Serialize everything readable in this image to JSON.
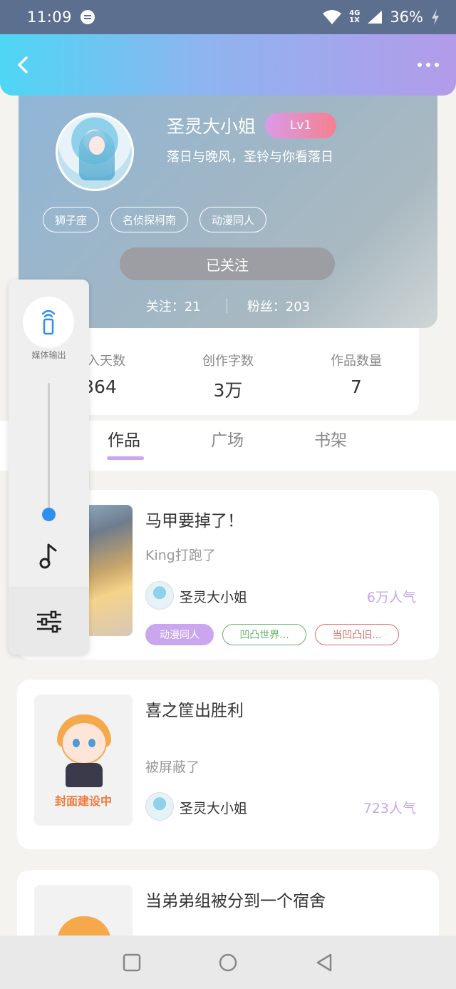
{
  "status_bar": {
    "time": "11:09",
    "network_top": "4G",
    "network_bottom": "1X",
    "battery": "36%"
  },
  "header": {
    "back_icon": "back-arrow-icon",
    "more_icon": "more-dots-icon"
  },
  "profile": {
    "name": "圣灵大小姐",
    "level": "Lv1",
    "signature": "落日与晚风，圣铃与你看落日",
    "tags": [
      "狮子座",
      "名侦探柯南",
      "动漫同人"
    ],
    "follow_button": "已关注",
    "following": "关注：21",
    "followers": "粉丝：203"
  },
  "stats": [
    {
      "label": "加入天数",
      "value": "364"
    },
    {
      "label": "创作字数",
      "value": "3万"
    },
    {
      "label": "作品数量",
      "value": "7"
    }
  ],
  "tabs": [
    "作品",
    "广场",
    "书架"
  ],
  "works": [
    {
      "title": "马甲要掉了！",
      "desc": "King打跑了",
      "author": "圣灵大小姐",
      "popularity": "6万人气",
      "tags": [
        {
          "text": "动漫同人",
          "style": "filled",
          "color": "#c9a6ee"
        },
        {
          "text": "凹凸世界...",
          "style": "outline",
          "color": "#62b46b"
        },
        {
          "text": "当凹凸旧...",
          "style": "outline",
          "color": "#e26a6a"
        }
      ]
    },
    {
      "title": "喜之筐出胜利",
      "desc": "被屏蔽了",
      "author": "圣灵大小姐",
      "popularity": "723人气",
      "cover_label": "封面建设中"
    },
    {
      "title": "当弟弟组被分到一个宿舍"
    }
  ],
  "volume_panel": {
    "output_label": "媒体输出",
    "level_fraction": 0.05,
    "music_icon": "music-note-icon",
    "settings_icon": "equalizer-icon"
  },
  "colors": {
    "accent": "#c9a6ee",
    "header_start": "#4ed6f5",
    "header_end": "#b39bea",
    "slider": "#2f8ff0"
  }
}
